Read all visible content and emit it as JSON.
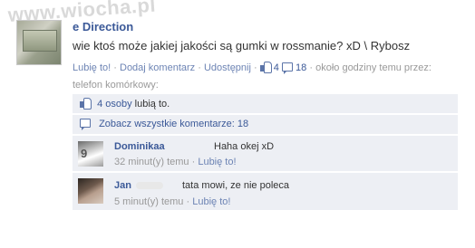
{
  "watermark": "www.wiocha.pl",
  "post": {
    "author_visible": "e Direction",
    "text": "wie ktoś może jakiej jakości są gumki w rossmanie? xD \\ Rybosz",
    "actions": {
      "like": "Lubię to!",
      "comment": "Dodaj komentarz",
      "share": "Udostępnij",
      "separator": "·",
      "likes_count": "4",
      "comments_count": "18",
      "time_source": "około godziny temu przez: telefon komórkowy:"
    }
  },
  "likes_row": {
    "link": "4 osoby",
    "text": " lubią to."
  },
  "view_all": {
    "text": "Zobacz wszystkie komentarze: 18"
  },
  "comments": [
    {
      "author": "Dominikaa",
      "text": "Haha okej xD",
      "time": "32 minut(y) temu",
      "separator": "·",
      "like": "Lubię to!"
    },
    {
      "author": "Jan",
      "text": "tata mowi, ze nie poleca",
      "time": "5 minut(y) temu",
      "separator": "·",
      "like": "Lubię to!"
    }
  ],
  "icons": {
    "like": "thumbs-up-icon",
    "comment": "comment-bubble-icon"
  },
  "colors": {
    "link": "#3b5998",
    "meta_link": "#6d84b4",
    "ufi_bg": "#edeff4",
    "meta_text": "#999999"
  }
}
